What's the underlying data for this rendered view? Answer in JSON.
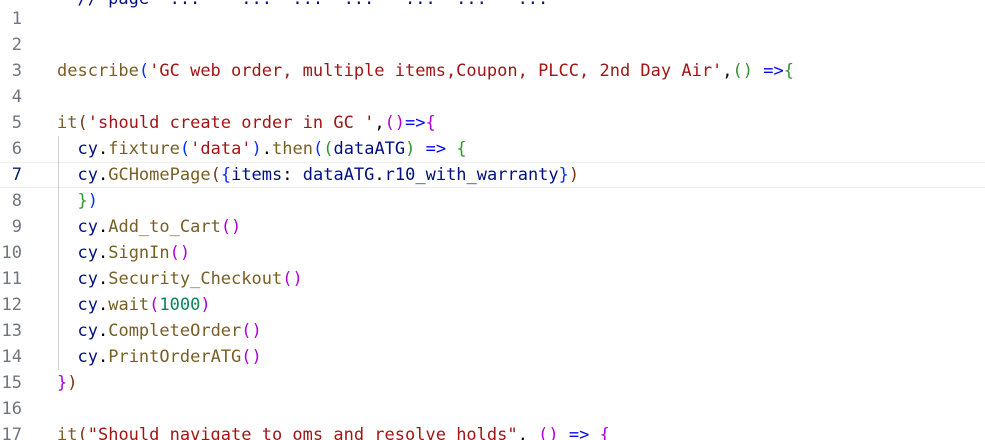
{
  "editor": {
    "lines": [
      {
        "num": "",
        "active": false,
        "y": -14,
        "tokens": [
          {
            "t": "  // page  ...    ...  ...  ...   ...  ...   ...",
            "c": "tok-var"
          }
        ]
      },
      {
        "num": "1",
        "active": false,
        "tokens": []
      },
      {
        "num": "2",
        "active": false,
        "tokens": []
      },
      {
        "num": "3",
        "active": false,
        "tokens": [
          {
            "t": "describe",
            "c": "tok-fn"
          },
          {
            "t": "(",
            "c": "tok-p1"
          },
          {
            "t": "'GC web order, multiple items,Coupon, PLCC, 2nd Day Air'",
            "c": "tok-str"
          },
          {
            "t": ",",
            "c": "tok-fg"
          },
          {
            "t": "()",
            "c": "tok-p2"
          },
          {
            "t": " ",
            "c": "tok-fg"
          },
          {
            "t": "=>",
            "c": "tok-kw"
          },
          {
            "t": "{",
            "c": "tok-p2"
          }
        ]
      },
      {
        "num": "4",
        "active": false,
        "tokens": []
      },
      {
        "num": "5",
        "active": false,
        "tokens": [
          {
            "t": "it",
            "c": "tok-fn"
          },
          {
            "t": "(",
            "c": "tok-p3"
          },
          {
            "t": "'should create order in GC '",
            "c": "tok-str"
          },
          {
            "t": ",",
            "c": "tok-fg"
          },
          {
            "t": "()",
            "c": "tok-pu"
          },
          {
            "t": "=>",
            "c": "tok-kw"
          },
          {
            "t": "{",
            "c": "tok-pu"
          }
        ]
      },
      {
        "num": "6",
        "active": false,
        "tokens": [
          {
            "t": "  ",
            "c": "tok-fg"
          },
          {
            "t": "cy",
            "c": "tok-var"
          },
          {
            "t": ".",
            "c": "tok-fg"
          },
          {
            "t": "fixture",
            "c": "tok-fn"
          },
          {
            "t": "(",
            "c": "tok-p1"
          },
          {
            "t": "'data'",
            "c": "tok-str"
          },
          {
            "t": ")",
            "c": "tok-p1"
          },
          {
            "t": ".",
            "c": "tok-fg"
          },
          {
            "t": "then",
            "c": "tok-fn"
          },
          {
            "t": "(",
            "c": "tok-p1"
          },
          {
            "t": "(",
            "c": "tok-p2"
          },
          {
            "t": "dataATG",
            "c": "tok-var"
          },
          {
            "t": ")",
            "c": "tok-p2"
          },
          {
            "t": " ",
            "c": "tok-fg"
          },
          {
            "t": "=>",
            "c": "tok-kw"
          },
          {
            "t": " ",
            "c": "tok-fg"
          },
          {
            "t": "{",
            "c": "tok-p2"
          }
        ]
      },
      {
        "num": "7",
        "active": true,
        "tokens": [
          {
            "t": "  ",
            "c": "tok-fg"
          },
          {
            "t": "cy",
            "c": "tok-var"
          },
          {
            "t": ".",
            "c": "tok-fg"
          },
          {
            "t": "GCHomePage",
            "c": "tok-fn"
          },
          {
            "t": "(",
            "c": "tok-p3"
          },
          {
            "t": "{",
            "c": "tok-p1"
          },
          {
            "t": "items",
            "c": "tok-var"
          },
          {
            "t": ": ",
            "c": "tok-fg"
          },
          {
            "t": "dataATG",
            "c": "tok-var"
          },
          {
            "t": ".",
            "c": "tok-fg"
          },
          {
            "t": "r10_with_warranty",
            "c": "tok-var"
          },
          {
            "t": "}",
            "c": "tok-p1"
          },
          {
            "t": ")",
            "c": "tok-p3"
          }
        ]
      },
      {
        "num": "8",
        "active": false,
        "tokens": [
          {
            "t": "  ",
            "c": "tok-fg"
          },
          {
            "t": "}",
            "c": "tok-p2"
          },
          {
            "t": ")",
            "c": "tok-p1"
          }
        ]
      },
      {
        "num": "9",
        "active": false,
        "tokens": [
          {
            "t": "  ",
            "c": "tok-fg"
          },
          {
            "t": "cy",
            "c": "tok-var"
          },
          {
            "t": ".",
            "c": "tok-fg"
          },
          {
            "t": "Add_to_Cart",
            "c": "tok-fn"
          },
          {
            "t": "()",
            "c": "tok-pu"
          }
        ]
      },
      {
        "num": "10",
        "active": false,
        "tokens": [
          {
            "t": "  ",
            "c": "tok-fg"
          },
          {
            "t": "cy",
            "c": "tok-var"
          },
          {
            "t": ".",
            "c": "tok-fg"
          },
          {
            "t": "SignIn",
            "c": "tok-fn"
          },
          {
            "t": "()",
            "c": "tok-pu"
          }
        ]
      },
      {
        "num": "11",
        "active": false,
        "tokens": [
          {
            "t": "  ",
            "c": "tok-fg"
          },
          {
            "t": "cy",
            "c": "tok-var"
          },
          {
            "t": ".",
            "c": "tok-fg"
          },
          {
            "t": "Security_Checkout",
            "c": "tok-fn"
          },
          {
            "t": "()",
            "c": "tok-pu"
          }
        ]
      },
      {
        "num": "12",
        "active": false,
        "tokens": [
          {
            "t": "  ",
            "c": "tok-fg"
          },
          {
            "t": "cy",
            "c": "tok-var"
          },
          {
            "t": ".",
            "c": "tok-fg"
          },
          {
            "t": "wait",
            "c": "tok-fn"
          },
          {
            "t": "(",
            "c": "tok-pu"
          },
          {
            "t": "1000",
            "c": "tok-num"
          },
          {
            "t": ")",
            "c": "tok-pu"
          }
        ]
      },
      {
        "num": "13",
        "active": false,
        "tokens": [
          {
            "t": "  ",
            "c": "tok-fg"
          },
          {
            "t": "cy",
            "c": "tok-var"
          },
          {
            "t": ".",
            "c": "tok-fg"
          },
          {
            "t": "CompleteOrder",
            "c": "tok-fn"
          },
          {
            "t": "()",
            "c": "tok-pu"
          }
        ]
      },
      {
        "num": "14",
        "active": false,
        "tokens": [
          {
            "t": "  ",
            "c": "tok-fg"
          },
          {
            "t": "cy",
            "c": "tok-var"
          },
          {
            "t": ".",
            "c": "tok-fg"
          },
          {
            "t": "PrintOrderATG",
            "c": "tok-fn"
          },
          {
            "t": "()",
            "c": "tok-pu"
          }
        ]
      },
      {
        "num": "15",
        "active": false,
        "tokens": [
          {
            "t": "}",
            "c": "tok-pu"
          },
          {
            "t": ")",
            "c": "tok-p3"
          }
        ]
      },
      {
        "num": "16",
        "active": false,
        "tokens": []
      },
      {
        "num": "17",
        "active": false,
        "tokens": [
          {
            "t": "it",
            "c": "tok-fn"
          },
          {
            "t": "(",
            "c": "tok-p3"
          },
          {
            "t": "\"Should navigate to oms and resolve holds\"",
            "c": "tok-str"
          },
          {
            "t": ",",
            "c": "tok-fg"
          },
          {
            "t": " ",
            "c": "tok-fg"
          },
          {
            "t": "()",
            "c": "tok-pu"
          },
          {
            "t": " ",
            "c": "tok-fg"
          },
          {
            "t": "=>",
            "c": "tok-kw"
          },
          {
            "t": " ",
            "c": "tok-fg"
          },
          {
            "t": "{",
            "c": "tok-pu"
          }
        ]
      }
    ]
  }
}
